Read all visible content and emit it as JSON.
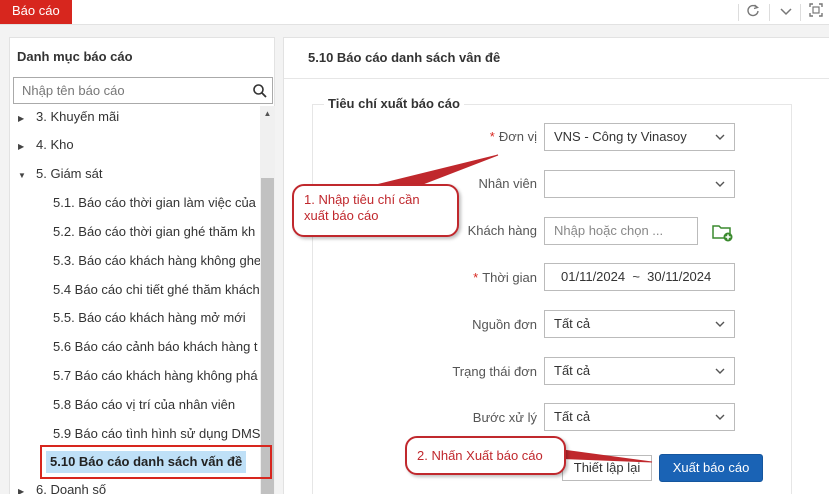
{
  "topbar": {
    "tab_label": "Báo cáo"
  },
  "sidebar": {
    "title": "Danh mục báo cáo",
    "search_placeholder": "Nhập tên báo cáo",
    "items": [
      {
        "label": "3. Khuyến mãi",
        "caret": "collapsed"
      },
      {
        "label": "4. Kho",
        "caret": "collapsed"
      },
      {
        "label": "5. Giám sát",
        "caret": "expanded"
      },
      {
        "label": "5.1. Báo cáo thời gian làm việc của"
      },
      {
        "label": "5.2. Báo cáo thời gian ghé thăm kh"
      },
      {
        "label": "5.3. Báo cáo khách hàng không ghe"
      },
      {
        "label": "5.4 Báo cáo chi tiết ghé thăm khách"
      },
      {
        "label": "5.5. Báo cáo khách hàng mở mới"
      },
      {
        "label": "5.6 Báo cáo cảnh báo khách hàng t"
      },
      {
        "label": "5.7 Báo cáo khách hàng không phá"
      },
      {
        "label": "5.8 Báo cáo vị trí của nhân viên"
      },
      {
        "label": "5.9 Báo cáo tình hình sử dụng DMS"
      },
      {
        "label": "6. Doanh số",
        "caret": "collapsed"
      }
    ],
    "selected_label": "5.10 Báo cáo danh sách vấn đề"
  },
  "main": {
    "title": "5.10 Báo cáo danh sách vân đê",
    "legend": "Tiêu chí xuất báo cáo",
    "fields": {
      "don_vi": {
        "label": "Đơn vị",
        "required": "*",
        "value": "VNS - Công ty Vinasoy"
      },
      "nhan_vien": {
        "label": "Nhân viên",
        "value": ""
      },
      "khach_hang": {
        "label": "Khách hàng",
        "placeholder": "Nhập hoặc chọn ..."
      },
      "thoi_gian": {
        "label": "Thời gian",
        "required": "*",
        "value": "01/11/2024  ~  30/11/2024"
      },
      "nguon_don": {
        "label": "Nguồn đơn",
        "value": "Tất cả"
      },
      "trang_thai_don": {
        "label": "Trạng thái đơn",
        "value": "Tất cả"
      },
      "buoc_xu_ly": {
        "label": "Bước xử lý",
        "value": "Tất cả"
      }
    },
    "reset_label": "Thiết lập lại",
    "export_label": "Xuất báo cáo"
  },
  "callouts": {
    "step1": "1. Nhập tiêu chí cần xuất báo cáo",
    "step2": "2. Nhấn Xuất báo cáo"
  },
  "colors": {
    "brand_red": "#d7261e",
    "primary_blue": "#1a63b5",
    "callout_red": "#c0282d"
  },
  "icons": [
    "refresh-icon",
    "chevron-down-icon",
    "fullscreen-icon",
    "search-icon",
    "folder-add-icon"
  ]
}
